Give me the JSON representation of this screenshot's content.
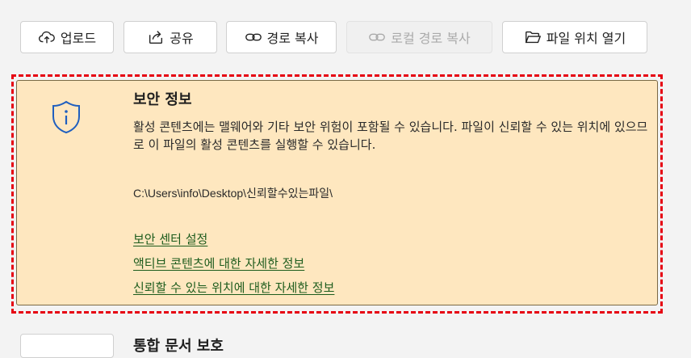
{
  "toolbar": {
    "upload": {
      "label": "업로드",
      "icon": "cloud-upload-icon"
    },
    "share": {
      "label": "공유",
      "icon": "share-icon"
    },
    "copy_path": {
      "label": "경로 복사",
      "icon": "link-icon"
    },
    "copy_local_path": {
      "label": "로컬 경로 복사",
      "icon": "link-icon",
      "disabled": true
    },
    "open_location": {
      "label": "파일 위치 열기",
      "icon": "folder-open-icon"
    }
  },
  "security_panel": {
    "icon": "shield-info-icon",
    "title": "보안 정보",
    "description": "활성 콘텐츠에는 맬웨어와 기타 보안 위험이 포함될 수 있습니다. 파일이 신뢰할 수 있는 위치에 있으므로 이 파일의 활성 콘텐츠를 실행할 수 있습니다.",
    "path": "C:\\Users\\info\\Desktop\\신뢰할수있는파일\\",
    "links": {
      "trust_center": "보안 센터 설정",
      "active_content": "액티브 콘텐츠에 대한 자세한 정보",
      "trusted_location": "신뢰할 수 있는 위치에 대한 자세한 정보"
    }
  },
  "next_section": {
    "title": "통합 문서 보호"
  },
  "colors": {
    "panel_bg": "#fee7bf",
    "highlight": "#e60012",
    "link": "#1d5c1d"
  }
}
